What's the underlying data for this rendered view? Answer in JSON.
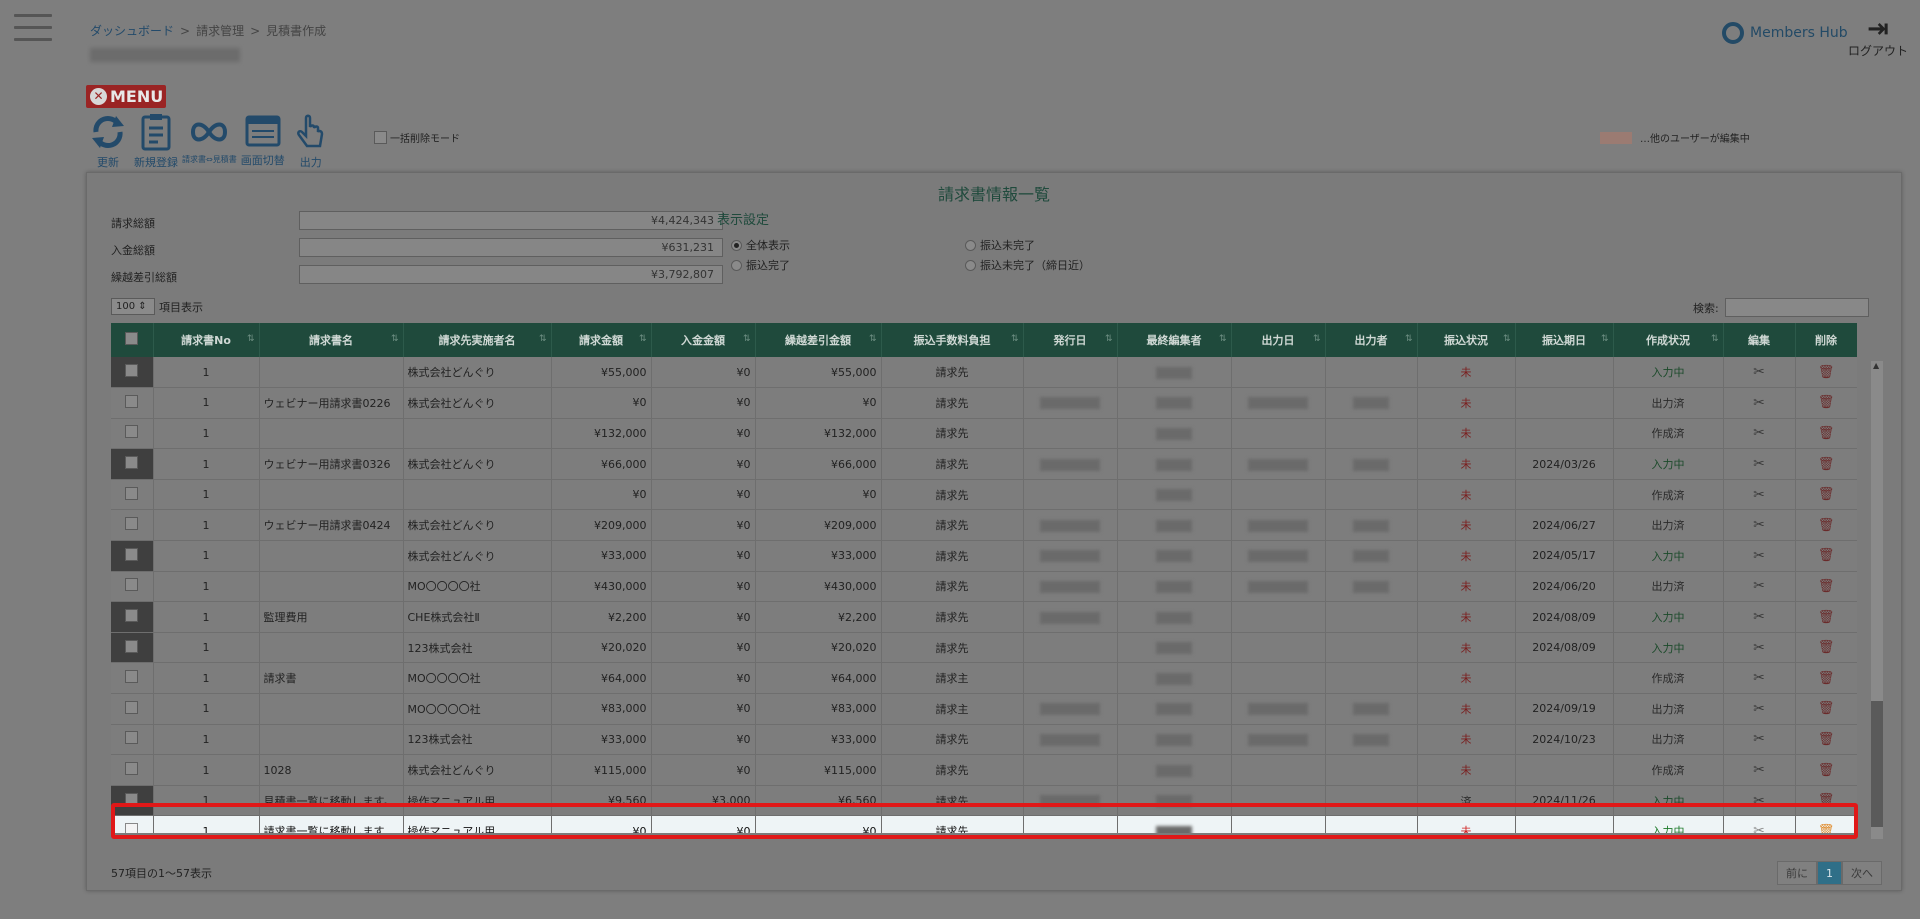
{
  "breadcrumb": [
    "ダッシュボード",
    "請求管理",
    "見積書作成"
  ],
  "brand": "Members Hub",
  "logout_label": "ログアウト",
  "menu_label": "MENU",
  "toolbar": [
    {
      "label": "更新",
      "icon": "refresh-icon"
    },
    {
      "label": "新規登録",
      "icon": "clipboard-icon"
    },
    {
      "label": "請求書⇔見積書",
      "icon": "infinity-icon"
    },
    {
      "label": "画面切替",
      "icon": "window-icon"
    },
    {
      "label": "出力",
      "icon": "hand-pointer-icon"
    }
  ],
  "bulk_delete_label": "一括削除モード",
  "legend_label": "…他のユーザーが編集中",
  "panel_title": "請求書情報一覧",
  "summary": [
    {
      "label": "請求総額",
      "value": "¥4,424,343"
    },
    {
      "label": "入金総額",
      "value": "¥631,231"
    },
    {
      "label": "繰越差引総額",
      "value": "¥3,792,807"
    }
  ],
  "display_settings": {
    "title": "表示設定",
    "options": [
      "全体表示",
      "振込未完了",
      "振込完了",
      "振込未完了（締日近）"
    ],
    "selected": 0
  },
  "per_page": {
    "value": "100",
    "label": "項目表示"
  },
  "search_label": "検索:",
  "columns": [
    "請求書No",
    "請求書名",
    "請求先実施者名",
    "請求金額",
    "入金金額",
    "繰越差引金額",
    "振込手数料負担",
    "発行日",
    "最終編集者",
    "出力日",
    "出力者",
    "振込状況",
    "振込期日",
    "作成状況",
    "編集",
    "削除"
  ],
  "rows": [
    {
      "dark": true,
      "no": "1",
      "name": "",
      "client": "株式会社どんぐり",
      "amount": "¥55,000",
      "paid": "¥0",
      "balance": "¥55,000",
      "fee": "請求先",
      "issued": false,
      "editor": true,
      "out_date": false,
      "outputter": false,
      "status": "未",
      "due": "",
      "state": "入力中"
    },
    {
      "dark": false,
      "no": "1",
      "name": "ウェビナー用請求書0226",
      "client": "株式会社どんぐり",
      "amount": "¥0",
      "paid": "¥0",
      "balance": "¥0",
      "fee": "請求先",
      "issued": true,
      "editor": true,
      "out_date": true,
      "outputter": true,
      "status": "未",
      "due": "",
      "state": "出力済"
    },
    {
      "dark": false,
      "no": "1",
      "name": "",
      "client": "",
      "amount": "¥132,000",
      "paid": "¥0",
      "balance": "¥132,000",
      "fee": "請求先",
      "issued": false,
      "editor": true,
      "out_date": false,
      "outputter": false,
      "status": "未",
      "due": "",
      "state": "作成済"
    },
    {
      "dark": true,
      "no": "1",
      "name": "ウェビナー用請求書0326",
      "client": "株式会社どんぐり",
      "amount": "¥66,000",
      "paid": "¥0",
      "balance": "¥66,000",
      "fee": "請求先",
      "issued": true,
      "editor": true,
      "out_date": true,
      "outputter": true,
      "status": "未",
      "due": "2024/03/26",
      "state": "入力中"
    },
    {
      "dark": false,
      "no": "1",
      "name": "",
      "client": "",
      "amount": "¥0",
      "paid": "¥0",
      "balance": "¥0",
      "fee": "請求先",
      "issued": false,
      "editor": true,
      "out_date": false,
      "outputter": false,
      "status": "未",
      "due": "",
      "state": "作成済"
    },
    {
      "dark": false,
      "no": "1",
      "name": "ウェビナー用請求書0424",
      "client": "株式会社どんぐり",
      "amount": "¥209,000",
      "paid": "¥0",
      "balance": "¥209,000",
      "fee": "請求先",
      "issued": true,
      "editor": true,
      "out_date": true,
      "outputter": true,
      "status": "未",
      "due": "2024/06/27",
      "state": "出力済"
    },
    {
      "dark": true,
      "no": "1",
      "name": "",
      "client": "株式会社どんぐり",
      "amount": "¥33,000",
      "paid": "¥0",
      "balance": "¥33,000",
      "fee": "請求先",
      "issued": true,
      "editor": true,
      "out_date": true,
      "outputter": true,
      "status": "未",
      "due": "2024/05/17",
      "state": "入力中"
    },
    {
      "dark": false,
      "no": "1",
      "name": "",
      "client": "MO〇〇〇〇社",
      "amount": "¥430,000",
      "paid": "¥0",
      "balance": "¥430,000",
      "fee": "請求先",
      "issued": true,
      "editor": true,
      "out_date": true,
      "outputter": true,
      "status": "未",
      "due": "2024/06/20",
      "state": "出力済"
    },
    {
      "dark": true,
      "no": "1",
      "name": "監理費用",
      "client": "CHE株式会社Ⅱ",
      "amount": "¥2,200",
      "paid": "¥0",
      "balance": "¥2,200",
      "fee": "請求先",
      "issued": true,
      "editor": true,
      "out_date": false,
      "outputter": false,
      "status": "未",
      "due": "2024/08/09",
      "state": "入力中"
    },
    {
      "dark": true,
      "no": "1",
      "name": "",
      "client": "123株式会社",
      "amount": "¥20,020",
      "paid": "¥0",
      "balance": "¥20,020",
      "fee": "請求先",
      "issued": false,
      "editor": true,
      "out_date": false,
      "outputter": false,
      "status": "未",
      "due": "2024/08/09",
      "state": "入力中"
    },
    {
      "dark": false,
      "no": "1",
      "name": "請求書",
      "client": "MO〇〇〇〇社",
      "amount": "¥64,000",
      "paid": "¥0",
      "balance": "¥64,000",
      "fee": "請求主",
      "issued": false,
      "editor": true,
      "out_date": false,
      "outputter": false,
      "status": "未",
      "due": "",
      "state": "作成済"
    },
    {
      "dark": false,
      "no": "1",
      "name": "",
      "client": "MO〇〇〇〇社",
      "amount": "¥83,000",
      "paid": "¥0",
      "balance": "¥83,000",
      "fee": "請求主",
      "issued": true,
      "editor": true,
      "out_date": true,
      "outputter": true,
      "status": "未",
      "due": "2024/09/19",
      "state": "出力済"
    },
    {
      "dark": false,
      "no": "1",
      "name": "",
      "client": "123株式会社",
      "amount": "¥33,000",
      "paid": "¥0",
      "balance": "¥33,000",
      "fee": "請求先",
      "issued": true,
      "editor": true,
      "out_date": true,
      "outputter": true,
      "status": "未",
      "due": "2024/10/23",
      "state": "出力済"
    },
    {
      "dark": false,
      "no": "1",
      "name": "1028",
      "client": "株式会社どんぐり",
      "amount": "¥115,000",
      "paid": "¥0",
      "balance": "¥115,000",
      "fee": "請求先",
      "issued": false,
      "editor": true,
      "out_date": false,
      "outputter": false,
      "status": "未",
      "due": "",
      "state": "作成済"
    },
    {
      "dark": true,
      "no": "1",
      "name": "見積書一覧に移動します。",
      "client": "操作マニュアル用",
      "amount": "¥9,560",
      "paid": "¥3,000",
      "balance": "¥6,560",
      "fee": "請求先",
      "issued": true,
      "editor": true,
      "out_date": false,
      "outputter": false,
      "status": "済",
      "due": "2024/11/26",
      "state": "入力中"
    },
    {
      "dark": false,
      "highlight": true,
      "no": "1",
      "name": "請求書一覧に移動します",
      "client": "操作マニュアル用",
      "amount": "¥0",
      "paid": "¥0",
      "balance": "¥0",
      "fee": "請求先",
      "issued": false,
      "editor": true,
      "out_date": false,
      "outputter": false,
      "status": "未",
      "due": "",
      "state": "入力中"
    }
  ],
  "footer_info": "57項目の1～57表示",
  "pager": {
    "prev": "前に",
    "current": "1",
    "next": "次へ"
  }
}
